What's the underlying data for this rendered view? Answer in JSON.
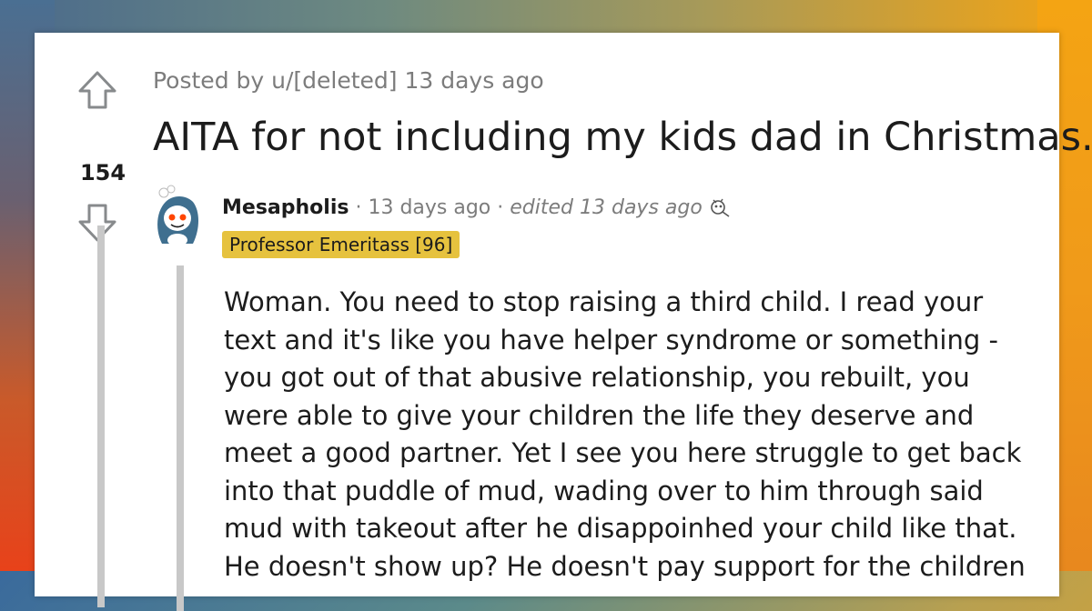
{
  "post": {
    "score": "154",
    "meta": "Posted by u/[deleted] 13 days ago",
    "title": "AITA for not including my kids dad in Christmas."
  },
  "comment": {
    "username": "Mesapholis",
    "time_sep": " · ",
    "time": "13 days ago",
    "edited_sep": " · ",
    "edited": "edited 13 days ago",
    "award_icon": "award-icon",
    "flair": "Professor Emeritass [96]",
    "body": "Woman. You need to stop raising a third child. I read your text and it's like you have helper syndrome or something - you got out of that abusive relationship, you rebuilt, you were able to give your children the life they deserve and meet a good partner. Yet I see you here struggle to get back into that puddle of mud, wading over to him through said mud with takeout after he disappoinhed your child like that. He doesn't show up? He doesn't pay support for the children"
  },
  "colors": {
    "flair_bg": "#e6c23e",
    "thread_line": "#c8c8c8",
    "text": "#1c1c1c",
    "muted": "#7c7c7c"
  }
}
